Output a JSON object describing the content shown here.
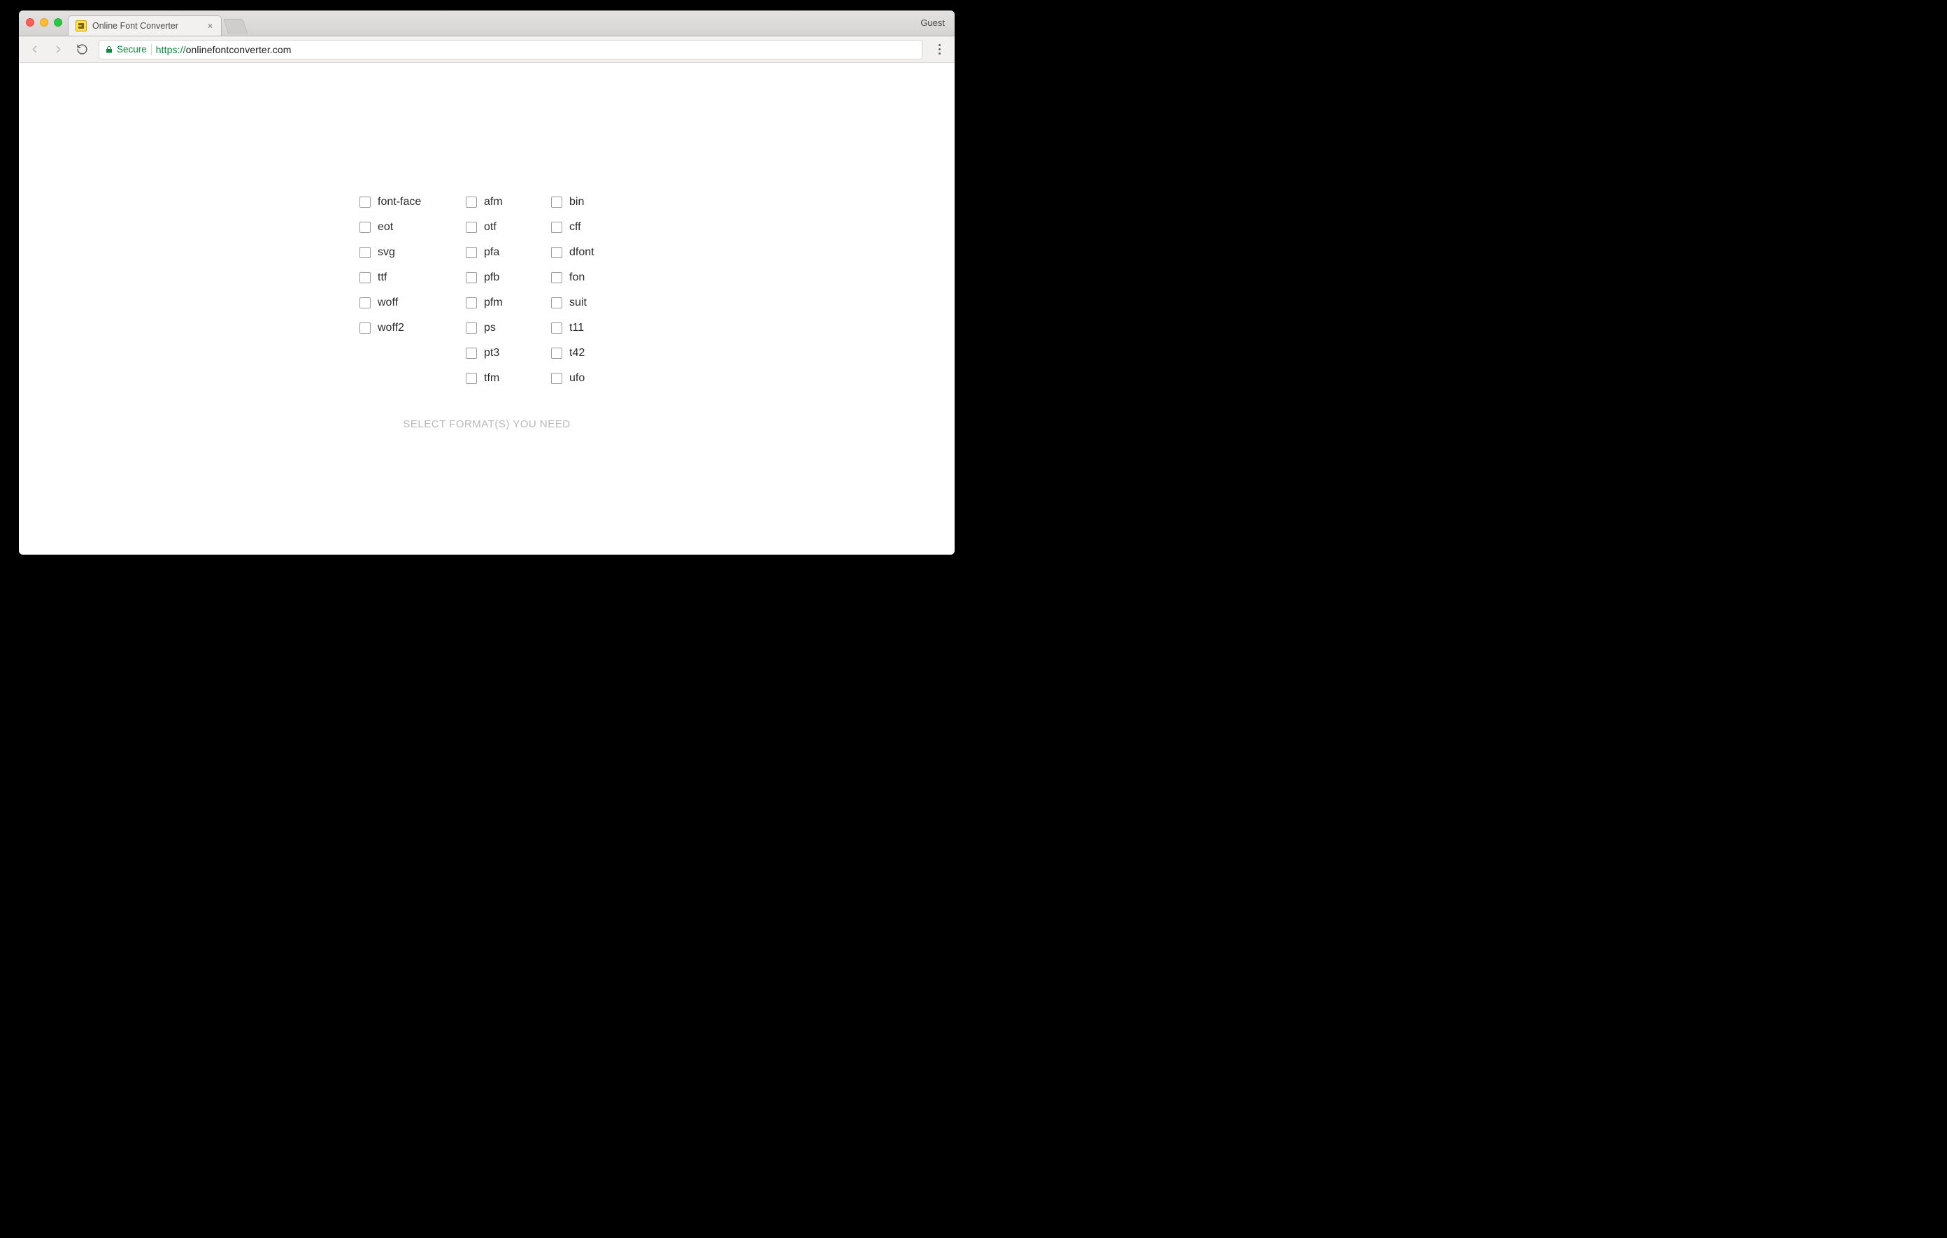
{
  "browser": {
    "tab_title": "Online Font Converter",
    "guest_label": "Guest",
    "secure_label": "Secure",
    "url_scheme": "https://",
    "url_host": "onlinefontconverter.com",
    "url_path": ""
  },
  "page": {
    "caption": "SELECT FORMAT(S) YOU NEED",
    "columns": [
      [
        "font-face",
        "eot",
        "svg",
        "ttf",
        "woff",
        "woff2"
      ],
      [
        "afm",
        "otf",
        "pfa",
        "pfb",
        "pfm",
        "ps",
        "pt3",
        "tfm"
      ],
      [
        "bin",
        "cff",
        "dfont",
        "fon",
        "suit",
        "t11",
        "t42",
        "ufo"
      ]
    ]
  }
}
